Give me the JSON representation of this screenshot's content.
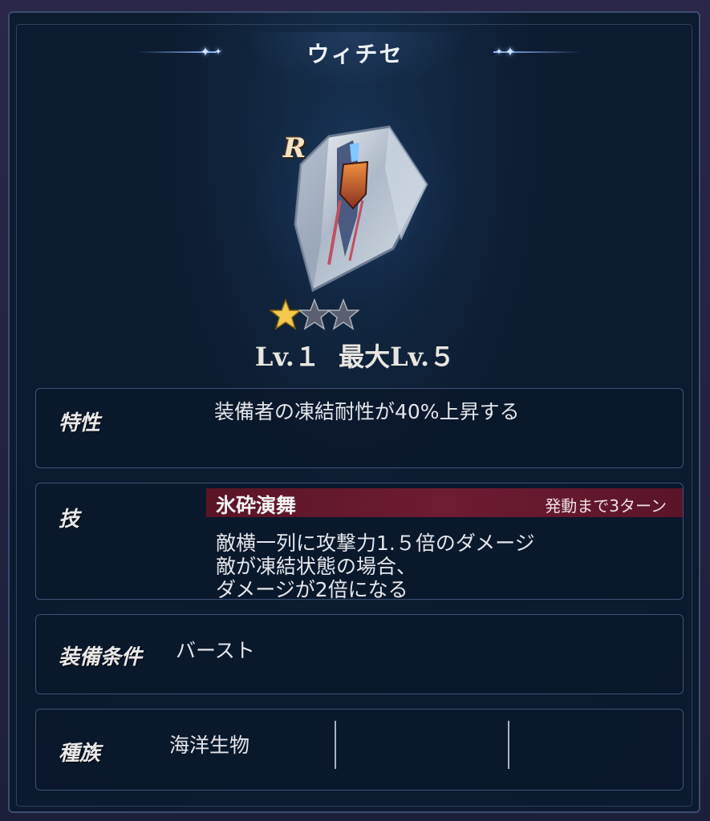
{
  "item": {
    "title": "ウィチセ",
    "rarity": "R",
    "stars_filled": 1,
    "stars_total": 3,
    "level_label": "Lv.１",
    "max_level_label": "最大Lv.５",
    "icon": "shield-icon"
  },
  "trait": {
    "label": "特性",
    "text": "装備者の凍結耐性が40%上昇する"
  },
  "skill": {
    "label": "技",
    "name": "氷砕演舞",
    "cooldown": "発動まで3ターン",
    "lines": [
      "敵横一列に攻撃力1.５倍のダメージ",
      "敵が凍結状態の場合、",
      "ダメージが2倍になる"
    ]
  },
  "equip": {
    "label": "装備条件",
    "value": "バースト"
  },
  "race": {
    "label": "種族",
    "values": [
      "海洋生物"
    ]
  },
  "colors": {
    "panel_bg": "#0b1a2e",
    "skill_bar": "#6e1c32",
    "star_gold": "#f2c94c",
    "star_empty": "#5a6070"
  }
}
